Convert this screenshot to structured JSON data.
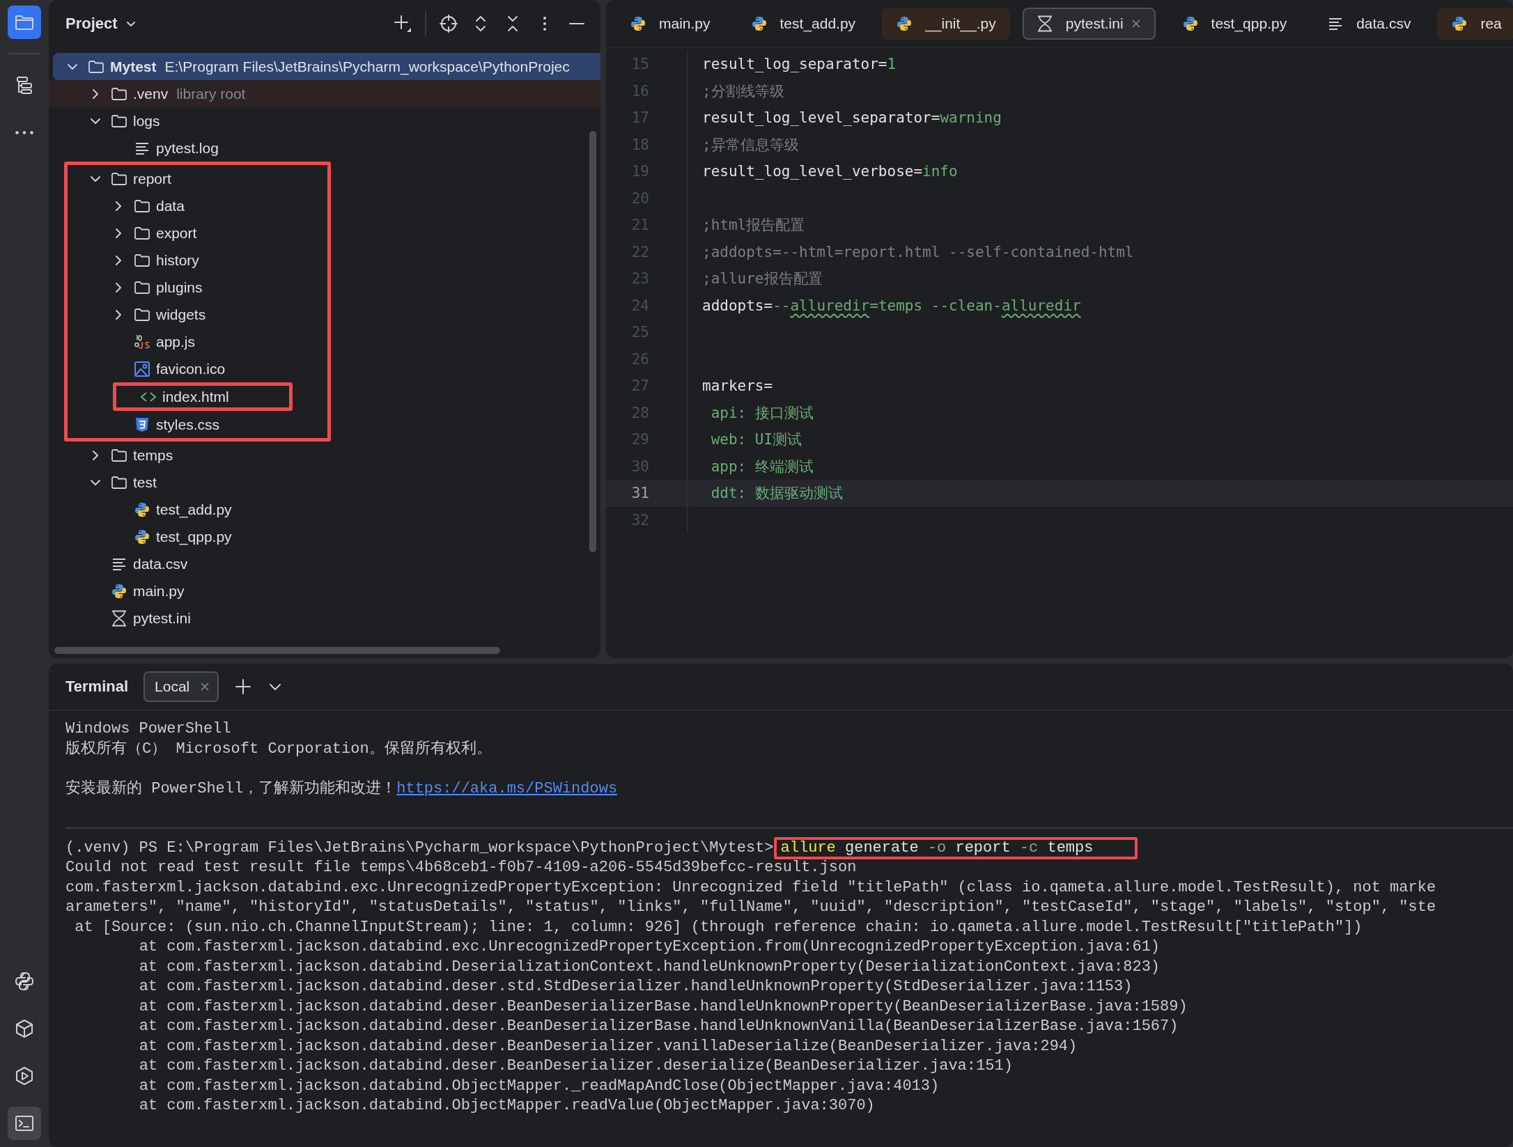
{
  "tool_strip": {
    "top": [
      {
        "kind": "project",
        "selected": true
      },
      {
        "kind": "structure",
        "selected": false
      },
      {
        "kind": "more",
        "selected": false
      }
    ],
    "bottom": [
      {
        "kind": "python_console",
        "selected": false
      },
      {
        "kind": "python_packages",
        "selected": false
      },
      {
        "kind": "run",
        "selected": false
      },
      {
        "kind": "terminal",
        "selected": true
      }
    ]
  },
  "project_panel": {
    "title": "Project",
    "tree": [
      {
        "label": "Mytest",
        "path": "E:\\Program Files\\JetBrains\\Pycharm_workspace\\PythonProjec",
        "kind": "folder",
        "expanded": true,
        "selected": true,
        "highlighted": false,
        "children": [
          {
            "label": ".venv",
            "hint": "library root",
            "kind": "library_root",
            "expanded": false,
            "selected": false,
            "highlighted": false
          },
          {
            "label": "logs",
            "kind": "folder",
            "expanded": true,
            "selected": false,
            "highlighted": false,
            "children": [
              {
                "label": "pytest.log",
                "kind": "text",
                "selected": false,
                "highlighted": false
              }
            ]
          },
          {
            "label": "report",
            "kind": "folder",
            "expanded": true,
            "selected": false,
            "highlighted": true,
            "children": [
              {
                "label": "data",
                "kind": "folder",
                "expanded": false,
                "selected": false,
                "highlighted": false
              },
              {
                "label": "export",
                "kind": "folder",
                "expanded": false,
                "selected": false,
                "highlighted": false
              },
              {
                "label": "history",
                "kind": "folder",
                "expanded": false,
                "selected": false,
                "highlighted": false
              },
              {
                "label": "plugins",
                "kind": "folder",
                "expanded": false,
                "selected": false,
                "highlighted": false
              },
              {
                "label": "widgets",
                "kind": "folder",
                "expanded": false,
                "selected": false,
                "highlighted": false
              },
              {
                "label": "app.js",
                "kind": "js",
                "selected": false,
                "highlighted": false
              },
              {
                "label": "favicon.ico",
                "kind": "image",
                "selected": false,
                "highlighted": false
              },
              {
                "label": "index.html",
                "kind": "html",
                "selected": false,
                "highlighted": true
              },
              {
                "label": "styles.css",
                "kind": "css",
                "selected": false,
                "highlighted": false
              }
            ]
          },
          {
            "label": "temps",
            "kind": "folder",
            "expanded": false,
            "selected": false,
            "highlighted": false
          },
          {
            "label": "test",
            "kind": "folder",
            "expanded": true,
            "selected": false,
            "highlighted": false,
            "children": [
              {
                "label": "test_add.py",
                "kind": "python",
                "selected": false,
                "highlighted": false
              },
              {
                "label": "test_qpp.py",
                "kind": "python",
                "selected": false,
                "highlighted": false
              }
            ]
          },
          {
            "label": "data.csv",
            "kind": "text",
            "selected": false,
            "highlighted": false
          },
          {
            "label": "main.py",
            "kind": "python",
            "selected": false,
            "highlighted": false
          },
          {
            "label": "pytest.ini",
            "kind": "ini",
            "selected": false,
            "highlighted": false
          }
        ]
      }
    ]
  },
  "editor": {
    "tabs": [
      {
        "label": "main.py",
        "kind": "python",
        "library": false,
        "selected": false
      },
      {
        "label": "test_add.py",
        "kind": "python",
        "library": false,
        "selected": false
      },
      {
        "label": "__init__.py",
        "kind": "python",
        "library": true,
        "selected": false
      },
      {
        "label": "pytest.ini",
        "kind": "ini",
        "library": false,
        "selected": true
      },
      {
        "label": "test_qpp.py",
        "kind": "python",
        "library": false,
        "selected": false
      },
      {
        "label": "data.csv",
        "kind": "text",
        "library": false,
        "selected": false
      },
      {
        "label": "rea",
        "kind": "python",
        "library": true,
        "selected": false
      }
    ],
    "lines": [
      {
        "number": "15",
        "current": false,
        "segments": [
          {
            "text": "result_log_separator=",
            "kind": "key"
          },
          {
            "text": "1",
            "kind": "value"
          }
        ]
      },
      {
        "number": "16",
        "current": false,
        "segments": [
          {
            "text": ";分割线等级",
            "kind": "comment"
          }
        ]
      },
      {
        "number": "17",
        "current": false,
        "segments": [
          {
            "text": "result_log_level_separator=",
            "kind": "key"
          },
          {
            "text": "warning",
            "kind": "value"
          }
        ]
      },
      {
        "number": "18",
        "current": false,
        "segments": [
          {
            "text": ";异常信息等级",
            "kind": "comment"
          }
        ]
      },
      {
        "number": "19",
        "current": false,
        "segments": [
          {
            "text": "result_log_level_verbose=",
            "kind": "key"
          },
          {
            "text": "info",
            "kind": "value"
          }
        ]
      },
      {
        "number": "20",
        "current": false
      },
      {
        "number": "21",
        "current": false,
        "segments": [
          {
            "text": ";html报告配置",
            "kind": "comment"
          }
        ]
      },
      {
        "number": "22",
        "current": false,
        "segments": [
          {
            "text": ";addopts=--html=report.html --self-contained-html",
            "kind": "comment"
          }
        ]
      },
      {
        "number": "23",
        "current": false,
        "segments": [
          {
            "text": ";allure报告配置",
            "kind": "comment"
          }
        ]
      },
      {
        "number": "24",
        "current": false,
        "segments": [
          {
            "text": "addopts=",
            "kind": "key"
          },
          {
            "text": "--",
            "kind": "value"
          },
          {
            "text": "alluredir",
            "kind": "typo"
          },
          {
            "text": "=temps --clean-",
            "kind": "value"
          },
          {
            "text": "alluredir",
            "kind": "typo"
          }
        ]
      },
      {
        "number": "25",
        "current": false
      },
      {
        "number": "26",
        "current": false
      },
      {
        "number": "27",
        "current": false,
        "segments": [
          {
            "text": "markers=",
            "kind": "key"
          }
        ]
      },
      {
        "number": "28",
        "current": false,
        "segments": [
          {
            "text": " api: 接口测试",
            "kind": "value"
          }
        ]
      },
      {
        "number": "29",
        "current": false,
        "segments": [
          {
            "text": " web: UI测试",
            "kind": "value"
          }
        ]
      },
      {
        "number": "30",
        "current": false,
        "segments": [
          {
            "text": " app: 终端测试",
            "kind": "value"
          }
        ]
      },
      {
        "number": "31",
        "current": true,
        "segments": [
          {
            "text": " ddt: 数据驱动测试",
            "kind": "value"
          }
        ]
      },
      {
        "number": "32",
        "current": false
      }
    ]
  },
  "terminal": {
    "title": "Terminal",
    "tabs": [
      {
        "label": "Local",
        "selected": true
      }
    ],
    "lines": [
      {
        "kind": "text",
        "segments": [
          {
            "text": "Windows PowerShell",
            "kind": "plain"
          }
        ]
      },
      {
        "kind": "text",
        "segments": [
          {
            "text": "版权所有（C） Microsoft Corporation。保留所有权利。",
            "kind": "plain"
          }
        ]
      },
      {
        "kind": "blank"
      },
      {
        "kind": "text",
        "segments": [
          {
            "text": "安装最新的 PowerShell，了解新功能和改进！",
            "kind": "plain"
          },
          {
            "text": "https://aka.ms/PSWindows",
            "kind": "link"
          }
        ]
      },
      {
        "kind": "blank"
      },
      {
        "kind": "separator"
      },
      {
        "kind": "prompt",
        "prompt": "(.venv) PS E:\\Program Files\\JetBrains\\Pycharm_workspace\\PythonProject\\Mytest>",
        "highlighted": true,
        "command": [
          {
            "text": "allure",
            "kind": "command"
          },
          {
            "text": " generate ",
            "kind": "plain"
          },
          {
            "text": "-o",
            "kind": "flag"
          },
          {
            "text": " report ",
            "kind": "plain"
          },
          {
            "text": "-c",
            "kind": "flag"
          },
          {
            "text": " temps",
            "kind": "plain"
          }
        ]
      },
      {
        "kind": "text",
        "segments": [
          {
            "text": "Could not read test result file temps\\4b68ceb1-f0b7-4109-a206-5545d39befcc-result.json",
            "kind": "plain"
          }
        ]
      },
      {
        "kind": "text",
        "segments": [
          {
            "text": "com.fasterxml.jackson.databind.exc.UnrecognizedPropertyException: Unrecognized field \"titlePath\" (class io.qameta.allure.model.TestResult), not marke",
            "kind": "plain"
          }
        ]
      },
      {
        "kind": "text",
        "segments": [
          {
            "text": "arameters\", \"name\", \"historyId\", \"statusDetails\", \"status\", \"links\", \"fullName\", \"uuid\", \"description\", \"testCaseId\", \"stage\", \"labels\", \"stop\", \"ste",
            "kind": "plain"
          }
        ]
      },
      {
        "kind": "text",
        "segments": [
          {
            "text": " at [Source: (sun.nio.ch.ChannelInputStream); line: 1, column: 926] (through reference chain: io.qameta.allure.model.TestResult[\"titlePath\"])",
            "kind": "plain"
          }
        ]
      },
      {
        "kind": "text",
        "segments": [
          {
            "text": "\tat com.fasterxml.jackson.databind.exc.UnrecognizedPropertyException.from(UnrecognizedPropertyException.java:61)",
            "kind": "plain"
          }
        ]
      },
      {
        "kind": "text",
        "segments": [
          {
            "text": "\tat com.fasterxml.jackson.databind.DeserializationContext.handleUnknownProperty(DeserializationContext.java:823)",
            "kind": "plain"
          }
        ]
      },
      {
        "kind": "text",
        "segments": [
          {
            "text": "\tat com.fasterxml.jackson.databind.deser.std.StdDeserializer.handleUnknownProperty(StdDeserializer.java:1153)",
            "kind": "plain"
          }
        ]
      },
      {
        "kind": "text",
        "segments": [
          {
            "text": "\tat com.fasterxml.jackson.databind.deser.BeanDeserializerBase.handleUnknownProperty(BeanDeserializerBase.java:1589)",
            "kind": "plain"
          }
        ]
      },
      {
        "kind": "text",
        "segments": [
          {
            "text": "\tat com.fasterxml.jackson.databind.deser.BeanDeserializerBase.handleUnknownVanilla(BeanDeserializerBase.java:1567)",
            "kind": "plain"
          }
        ]
      },
      {
        "kind": "text",
        "segments": [
          {
            "text": "\tat com.fasterxml.jackson.databind.deser.BeanDeserializer.vanillaDeserialize(BeanDeserializer.java:294)",
            "kind": "plain"
          }
        ]
      },
      {
        "kind": "text",
        "segments": [
          {
            "text": "\tat com.fasterxml.jackson.databind.deser.BeanDeserializer.deserialize(BeanDeserializer.java:151)",
            "kind": "plain"
          }
        ]
      },
      {
        "kind": "text",
        "segments": [
          {
            "text": "\tat com.fasterxml.jackson.databind.ObjectMapper._readMapAndClose(ObjectMapper.java:4013)",
            "kind": "plain"
          }
        ]
      },
      {
        "kind": "text",
        "segments": [
          {
            "text": "\tat com.fasterxml.jackson.databind.ObjectMapper.readValue(ObjectMapper.java:3070)",
            "kind": "plain"
          }
        ]
      }
    ]
  }
}
